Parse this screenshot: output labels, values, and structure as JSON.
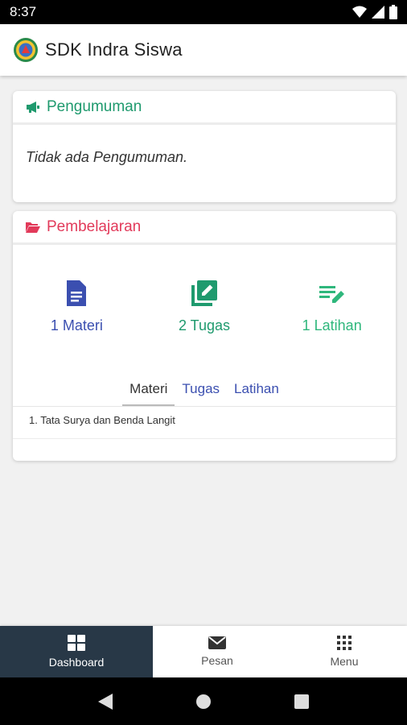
{
  "status": {
    "time": "8:37"
  },
  "app": {
    "title": "SDK Indra Siswa"
  },
  "announcements": {
    "title": "Pengumuman",
    "empty_text": "Tidak ada Pengumuman."
  },
  "learning": {
    "title": "Pembelajaran",
    "stats": [
      {
        "label": "1 Materi",
        "icon": "document-icon"
      },
      {
        "label": "2 Tugas",
        "icon": "edit-note-icon"
      },
      {
        "label": "1 Latihan",
        "icon": "edit-list-icon"
      }
    ],
    "tabs": [
      "Materi",
      "Tugas",
      "Latihan"
    ],
    "active_tab": "Materi",
    "items": [
      "1. Tata Surya dan Benda Langit"
    ]
  },
  "bottom_nav": [
    {
      "label": "Dashboard",
      "icon": "dashboard-icon"
    },
    {
      "label": "Pesan",
      "icon": "mail-icon"
    },
    {
      "label": "Menu",
      "icon": "grid-icon"
    }
  ],
  "colors": {
    "green": "#1f9a6e",
    "red": "#e23a5a",
    "blue": "#3b4fb0",
    "nav_active": "#283847"
  }
}
